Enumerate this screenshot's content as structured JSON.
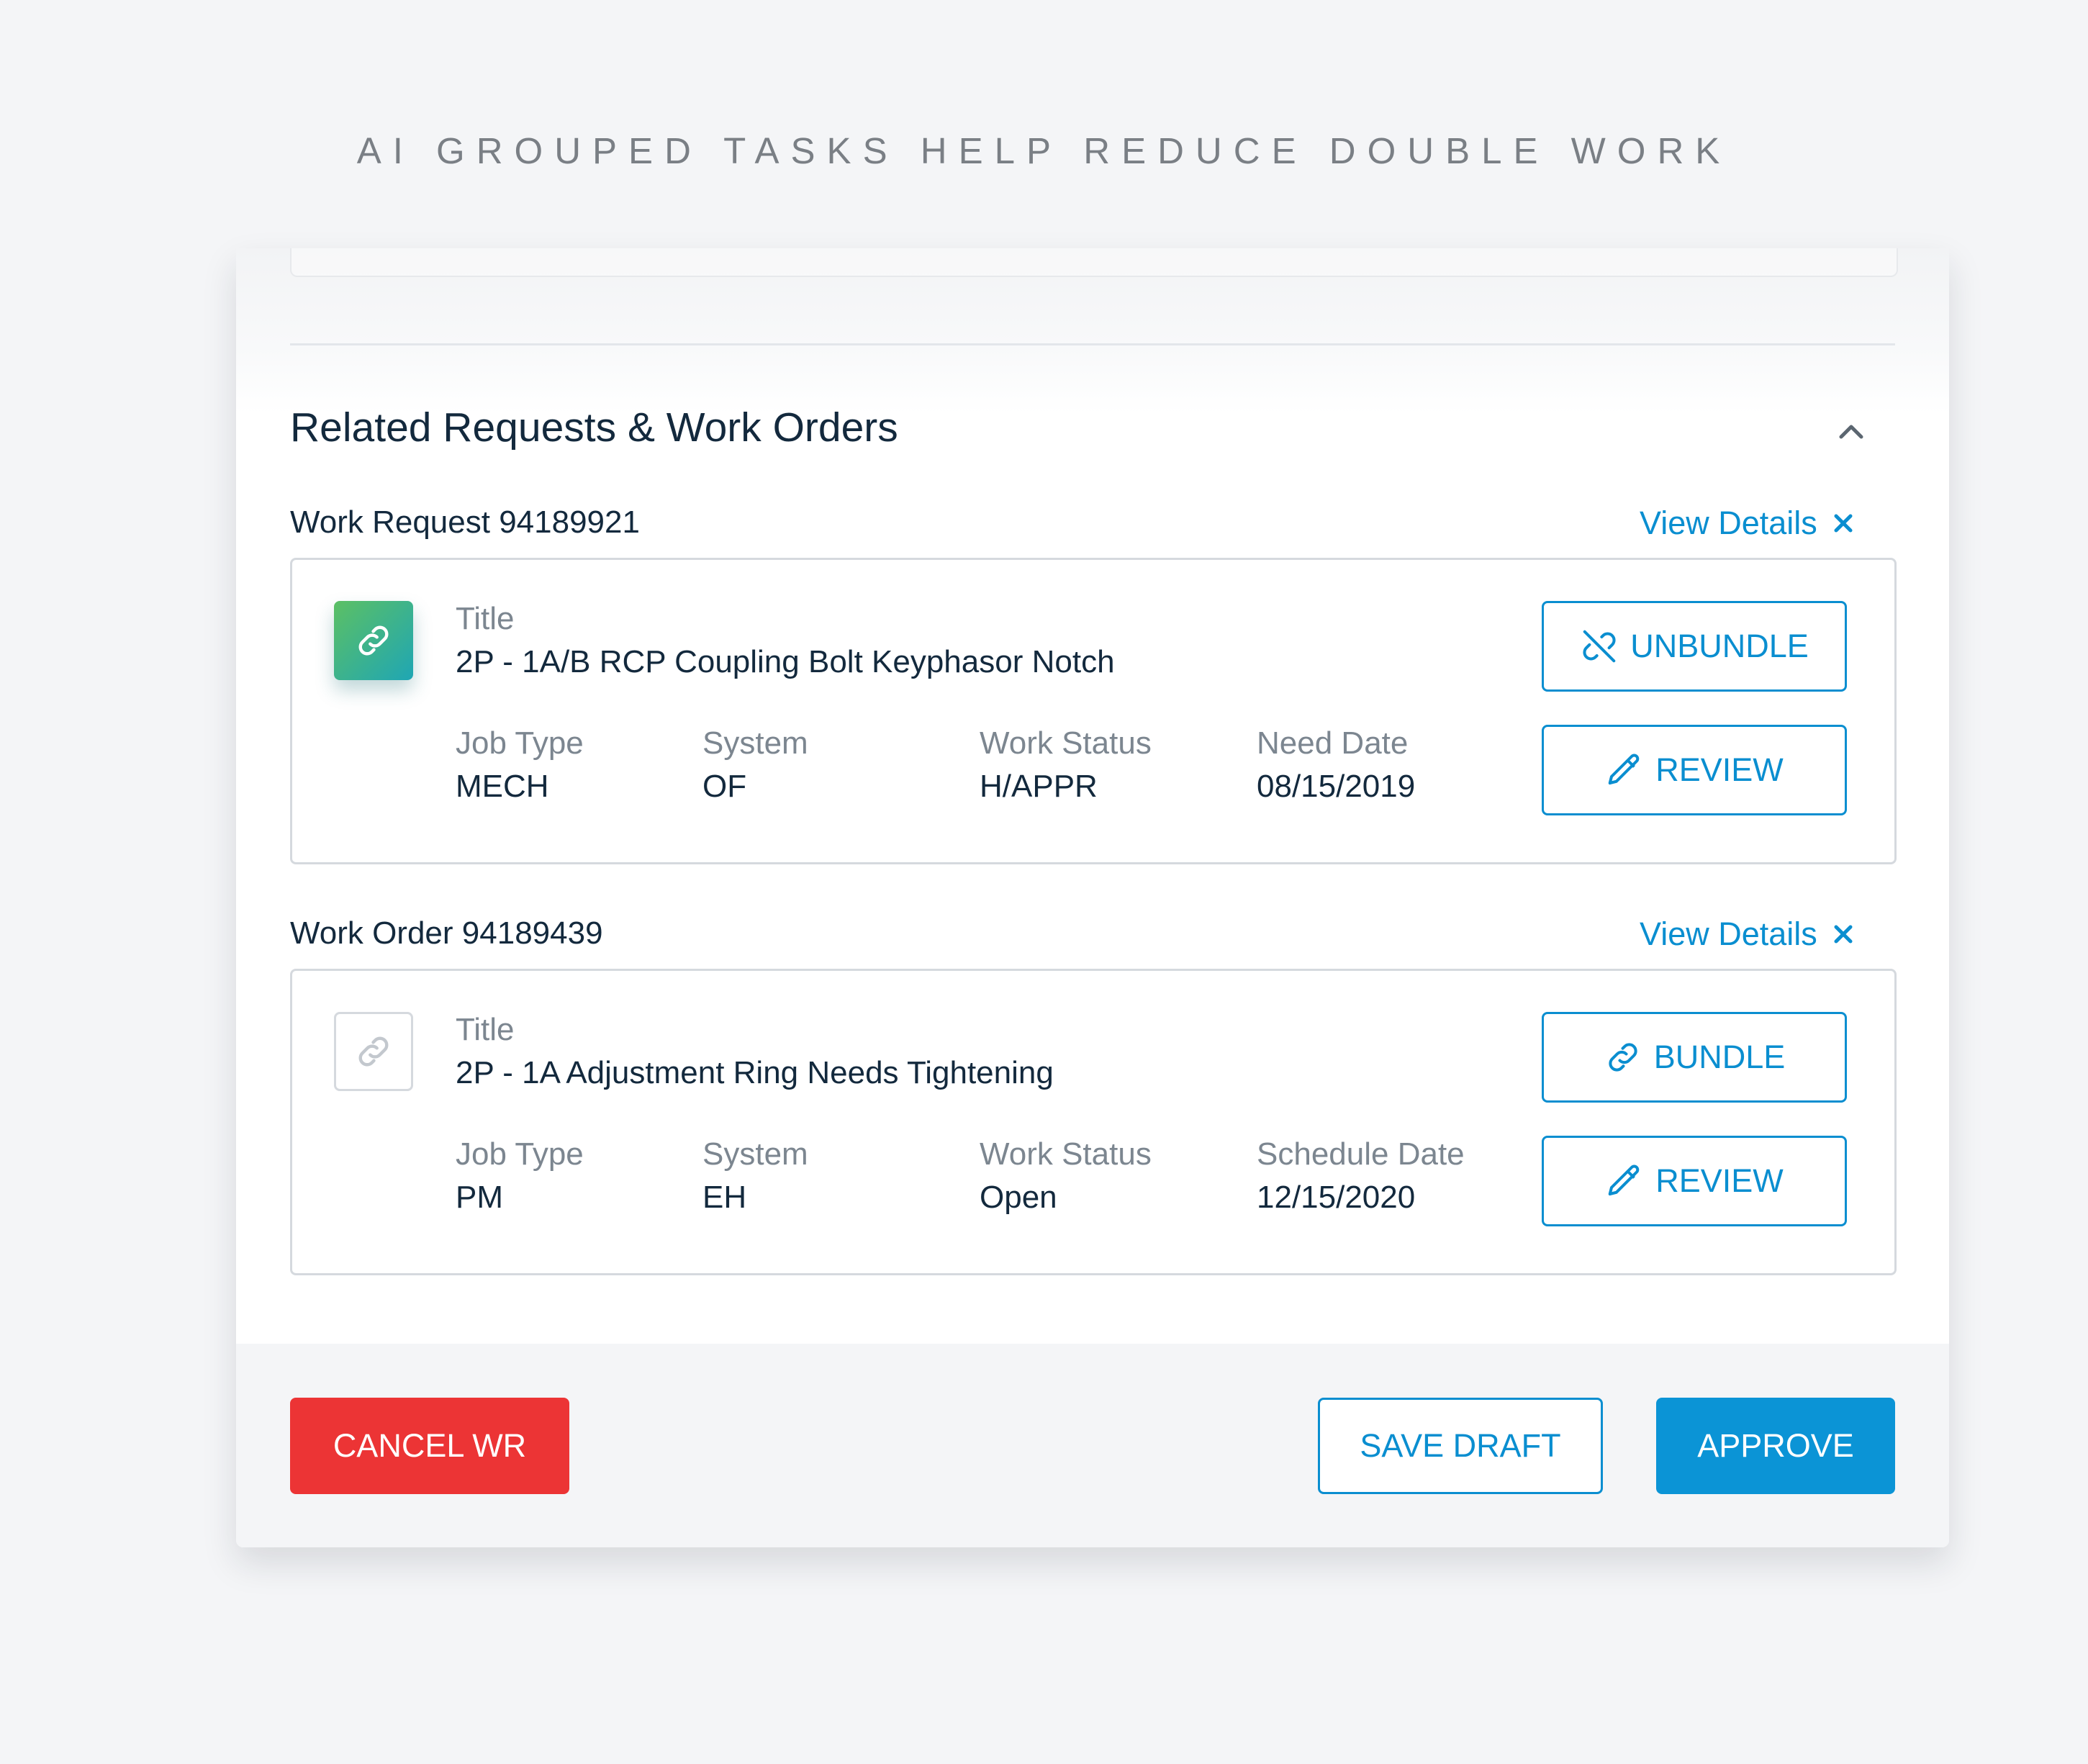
{
  "caption": "AI GROUPED TASKS HELP REDUCE DOUBLE WORK",
  "section": {
    "title": "Related Requests & Work Orders",
    "collapse_icon": "chevron-up-icon"
  },
  "items": [
    {
      "heading": "Work Request 94189921",
      "view_details": "View Details",
      "close_icon": "close-icon",
      "badge_state": "bundled",
      "badge_icon": "link-icon",
      "title_label": "Title",
      "title": "2P - 1A/B RCP Coupling Bolt Keyphasor Notch",
      "fields": [
        {
          "label": "Job Type",
          "value": "MECH"
        },
        {
          "label": "System",
          "value": "OF"
        },
        {
          "label": "Work Status",
          "value": "H/APPR"
        },
        {
          "label": "Need Date",
          "value": "08/15/2019"
        }
      ],
      "primary_button": {
        "label": "UNBUNDLE",
        "icon": "unlink-icon"
      },
      "review_button": {
        "label": "REVIEW",
        "icon": "pencil-icon"
      }
    },
    {
      "heading": "Work Order 94189439",
      "view_details": "View Details",
      "close_icon": "close-icon",
      "badge_state": "unbundled",
      "badge_icon": "link-icon",
      "title_label": "Title",
      "title": "2P - 1A Adjustment Ring Needs Tightening",
      "fields": [
        {
          "label": "Job Type",
          "value": "PM"
        },
        {
          "label": "System",
          "value": "EH"
        },
        {
          "label": "Work Status",
          "value": "Open"
        },
        {
          "label": "Schedule Date",
          "value": "12/15/2020"
        }
      ],
      "primary_button": {
        "label": "BUNDLE",
        "icon": "link-icon"
      },
      "review_button": {
        "label": "REVIEW",
        "icon": "pencil-icon"
      }
    }
  ],
  "footer": {
    "cancel_label": "CANCEL WR",
    "save_label": "SAVE DRAFT",
    "approve_label": "APPROVE"
  },
  "colors": {
    "accent": "#0a8ed0",
    "danger": "#ec3435",
    "approve": "#0b94d6",
    "badge_gradient_start": "#5cc064",
    "badge_gradient_end": "#1fa6b4"
  }
}
